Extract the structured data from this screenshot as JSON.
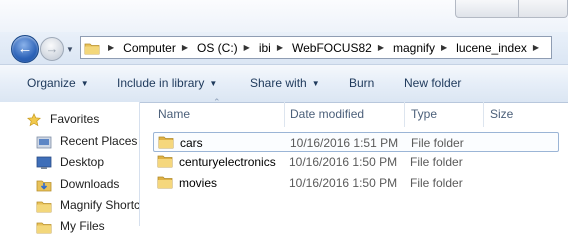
{
  "window": {
    "accent": "#2d63b8"
  },
  "nav_buttons": {
    "back_icon": "back-arrow",
    "forward_icon": "forward-arrow",
    "history_icon": "chevron-down"
  },
  "address": {
    "crumbs": [
      "Computer",
      "OS (C:)",
      "ibi",
      "WebFOCUS82",
      "magnify",
      "lucene_index"
    ]
  },
  "toolbar": {
    "organize": "Organize",
    "include": "Include in library",
    "share": "Share with",
    "burn": "Burn",
    "new_folder": "New folder"
  },
  "sidebar": {
    "items": [
      {
        "label": "Favorites",
        "icon": "star-icon"
      },
      {
        "label": "Recent Places",
        "icon": "recent-places-icon"
      },
      {
        "label": "Desktop",
        "icon": "desktop-icon"
      },
      {
        "label": "Downloads",
        "icon": "downloads-icon"
      },
      {
        "label": "Magnify Shortc",
        "icon": "folder-icon"
      },
      {
        "label": "My Files",
        "icon": "folder-icon"
      }
    ]
  },
  "columns": {
    "name": "Name",
    "date": "Date modified",
    "type": "Type",
    "size": "Size"
  },
  "files": [
    {
      "name": "cars",
      "date": "10/16/2016 1:51 PM",
      "type": "File folder"
    },
    {
      "name": "centuryelectronics",
      "date": "10/16/2016 1:50 PM",
      "type": "File folder"
    },
    {
      "name": "movies",
      "date": "10/16/2016 1:50 PM",
      "type": "File folder"
    }
  ]
}
